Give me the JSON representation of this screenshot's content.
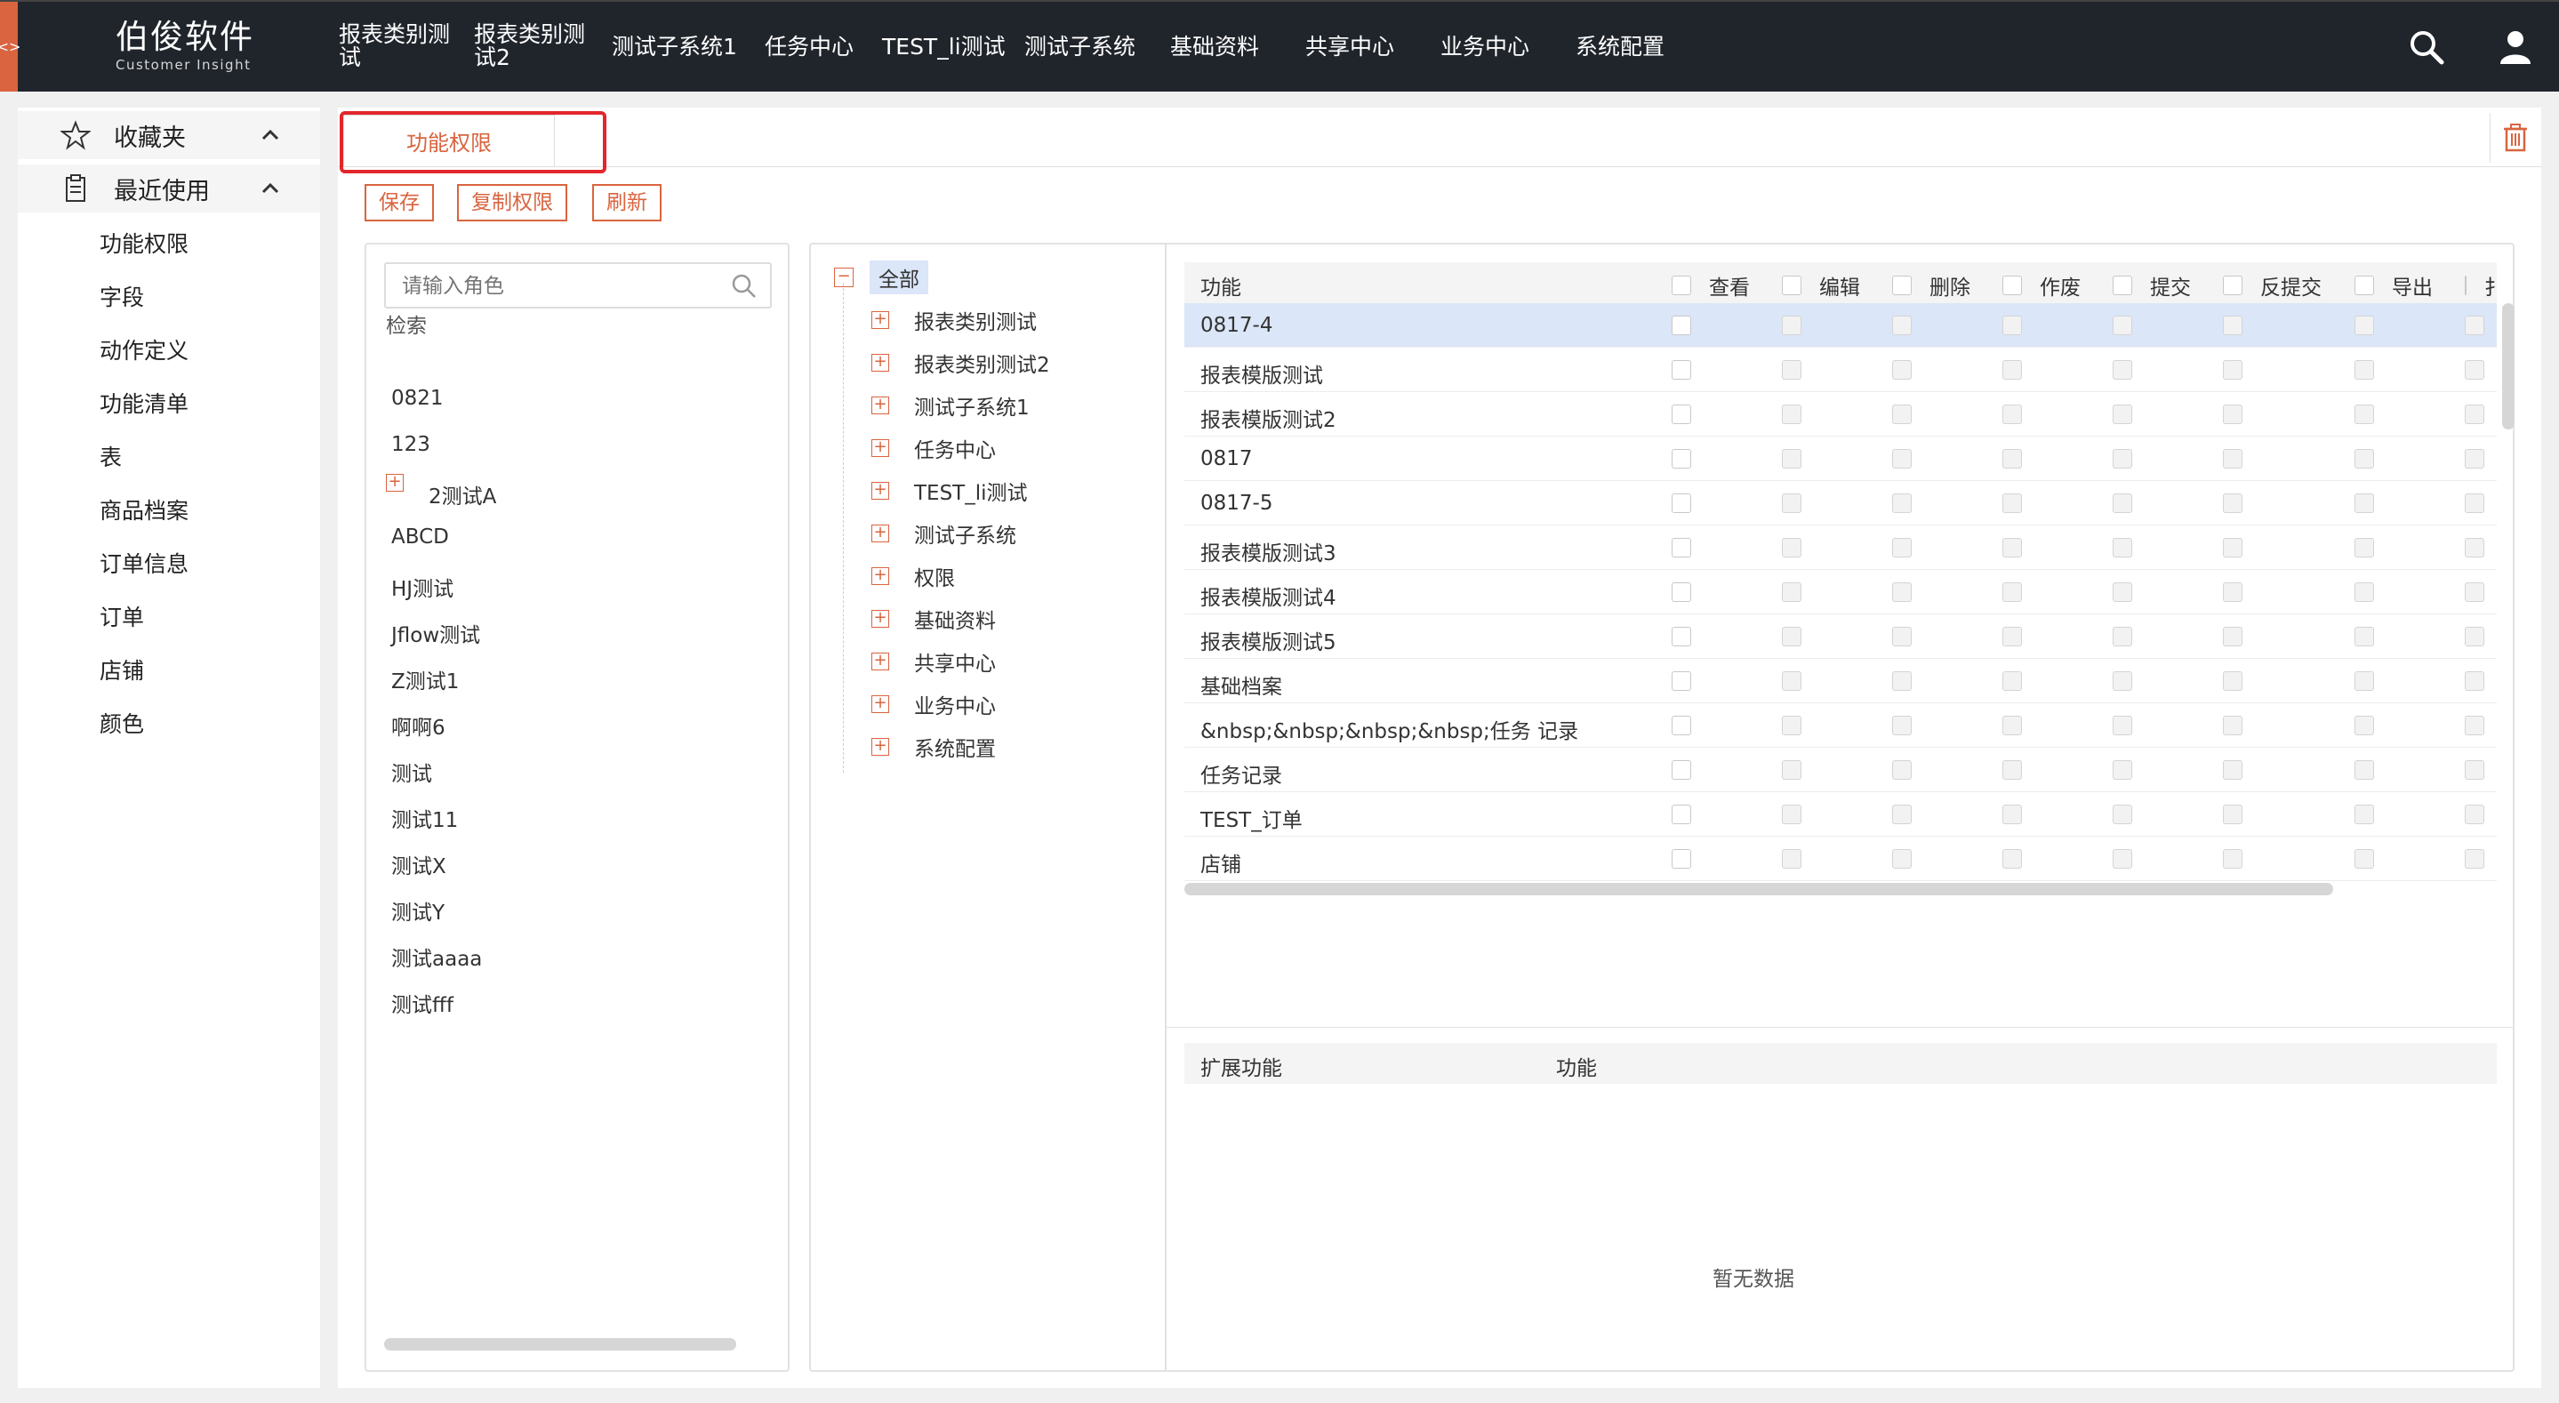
{
  "header": {
    "brand": "伯俊软件",
    "brand_sub": "Customer Insight",
    "nav": [
      "报表类别测试",
      "报表类别测试2",
      "测试子系统1",
      "任务中心",
      "TEST_li测试",
      "测试子系统",
      "基础资料",
      "共享中心",
      "业务中心",
      "系统配置"
    ],
    "icons": [
      "search-icon",
      "user-icon"
    ]
  },
  "sidebar": {
    "favorites": "收藏夹",
    "recent": "最近使用",
    "items": [
      "功能权限",
      "字段",
      "动作定义",
      "功能清单",
      "表",
      "商品档案",
      "订单信息",
      "订单",
      "店铺",
      "颜色"
    ]
  },
  "tabs": {
    "active": "功能权限"
  },
  "toolbar": {
    "save": "保存",
    "copy": "复制权限",
    "refresh": "刷新"
  },
  "roles": {
    "placeholder": "请输入角色",
    "search_label": "检索",
    "items": [
      "0821",
      "123",
      "2测试A",
      "ABCD",
      "HJ测试",
      "Jflow测试",
      "Z测试1",
      "啊啊6",
      "测试",
      "测试11",
      "测试X",
      "测试Y",
      "测试aaaa",
      "测试fff"
    ]
  },
  "tree": {
    "root": "全部",
    "nodes": [
      "报表类别测试",
      "报表类别测试2",
      "测试子系统1",
      "任务中心",
      "TEST_li测试",
      "测试子系统",
      "权限",
      "基础资料",
      "共享中心",
      "业务中心",
      "系统配置"
    ]
  },
  "permissions": {
    "function_header": "功能",
    "columns": [
      "查看",
      "编辑",
      "删除",
      "作废",
      "提交",
      "反提交",
      "导出",
      "扌"
    ],
    "rows": [
      "0817-4",
      "报表模版测试",
      "报表模版测试2",
      "0817",
      "0817-5",
      "报表模版测试3",
      "报表模版测试4",
      "报表模版测试5",
      "基础档案",
      "&nbsp;&nbsp;&nbsp;&nbsp;任务 记录",
      "任务记录",
      "TEST_订单",
      "店铺"
    ],
    "selected_row": "0817-4"
  },
  "extended": {
    "col1": "扩展功能",
    "col2": "功能",
    "empty": "暂无数据"
  },
  "colors": {
    "accent": "#d9643f",
    "header_bg": "#20252c",
    "highlight": "#e2262b",
    "selected_row": "#dbe6f8"
  }
}
